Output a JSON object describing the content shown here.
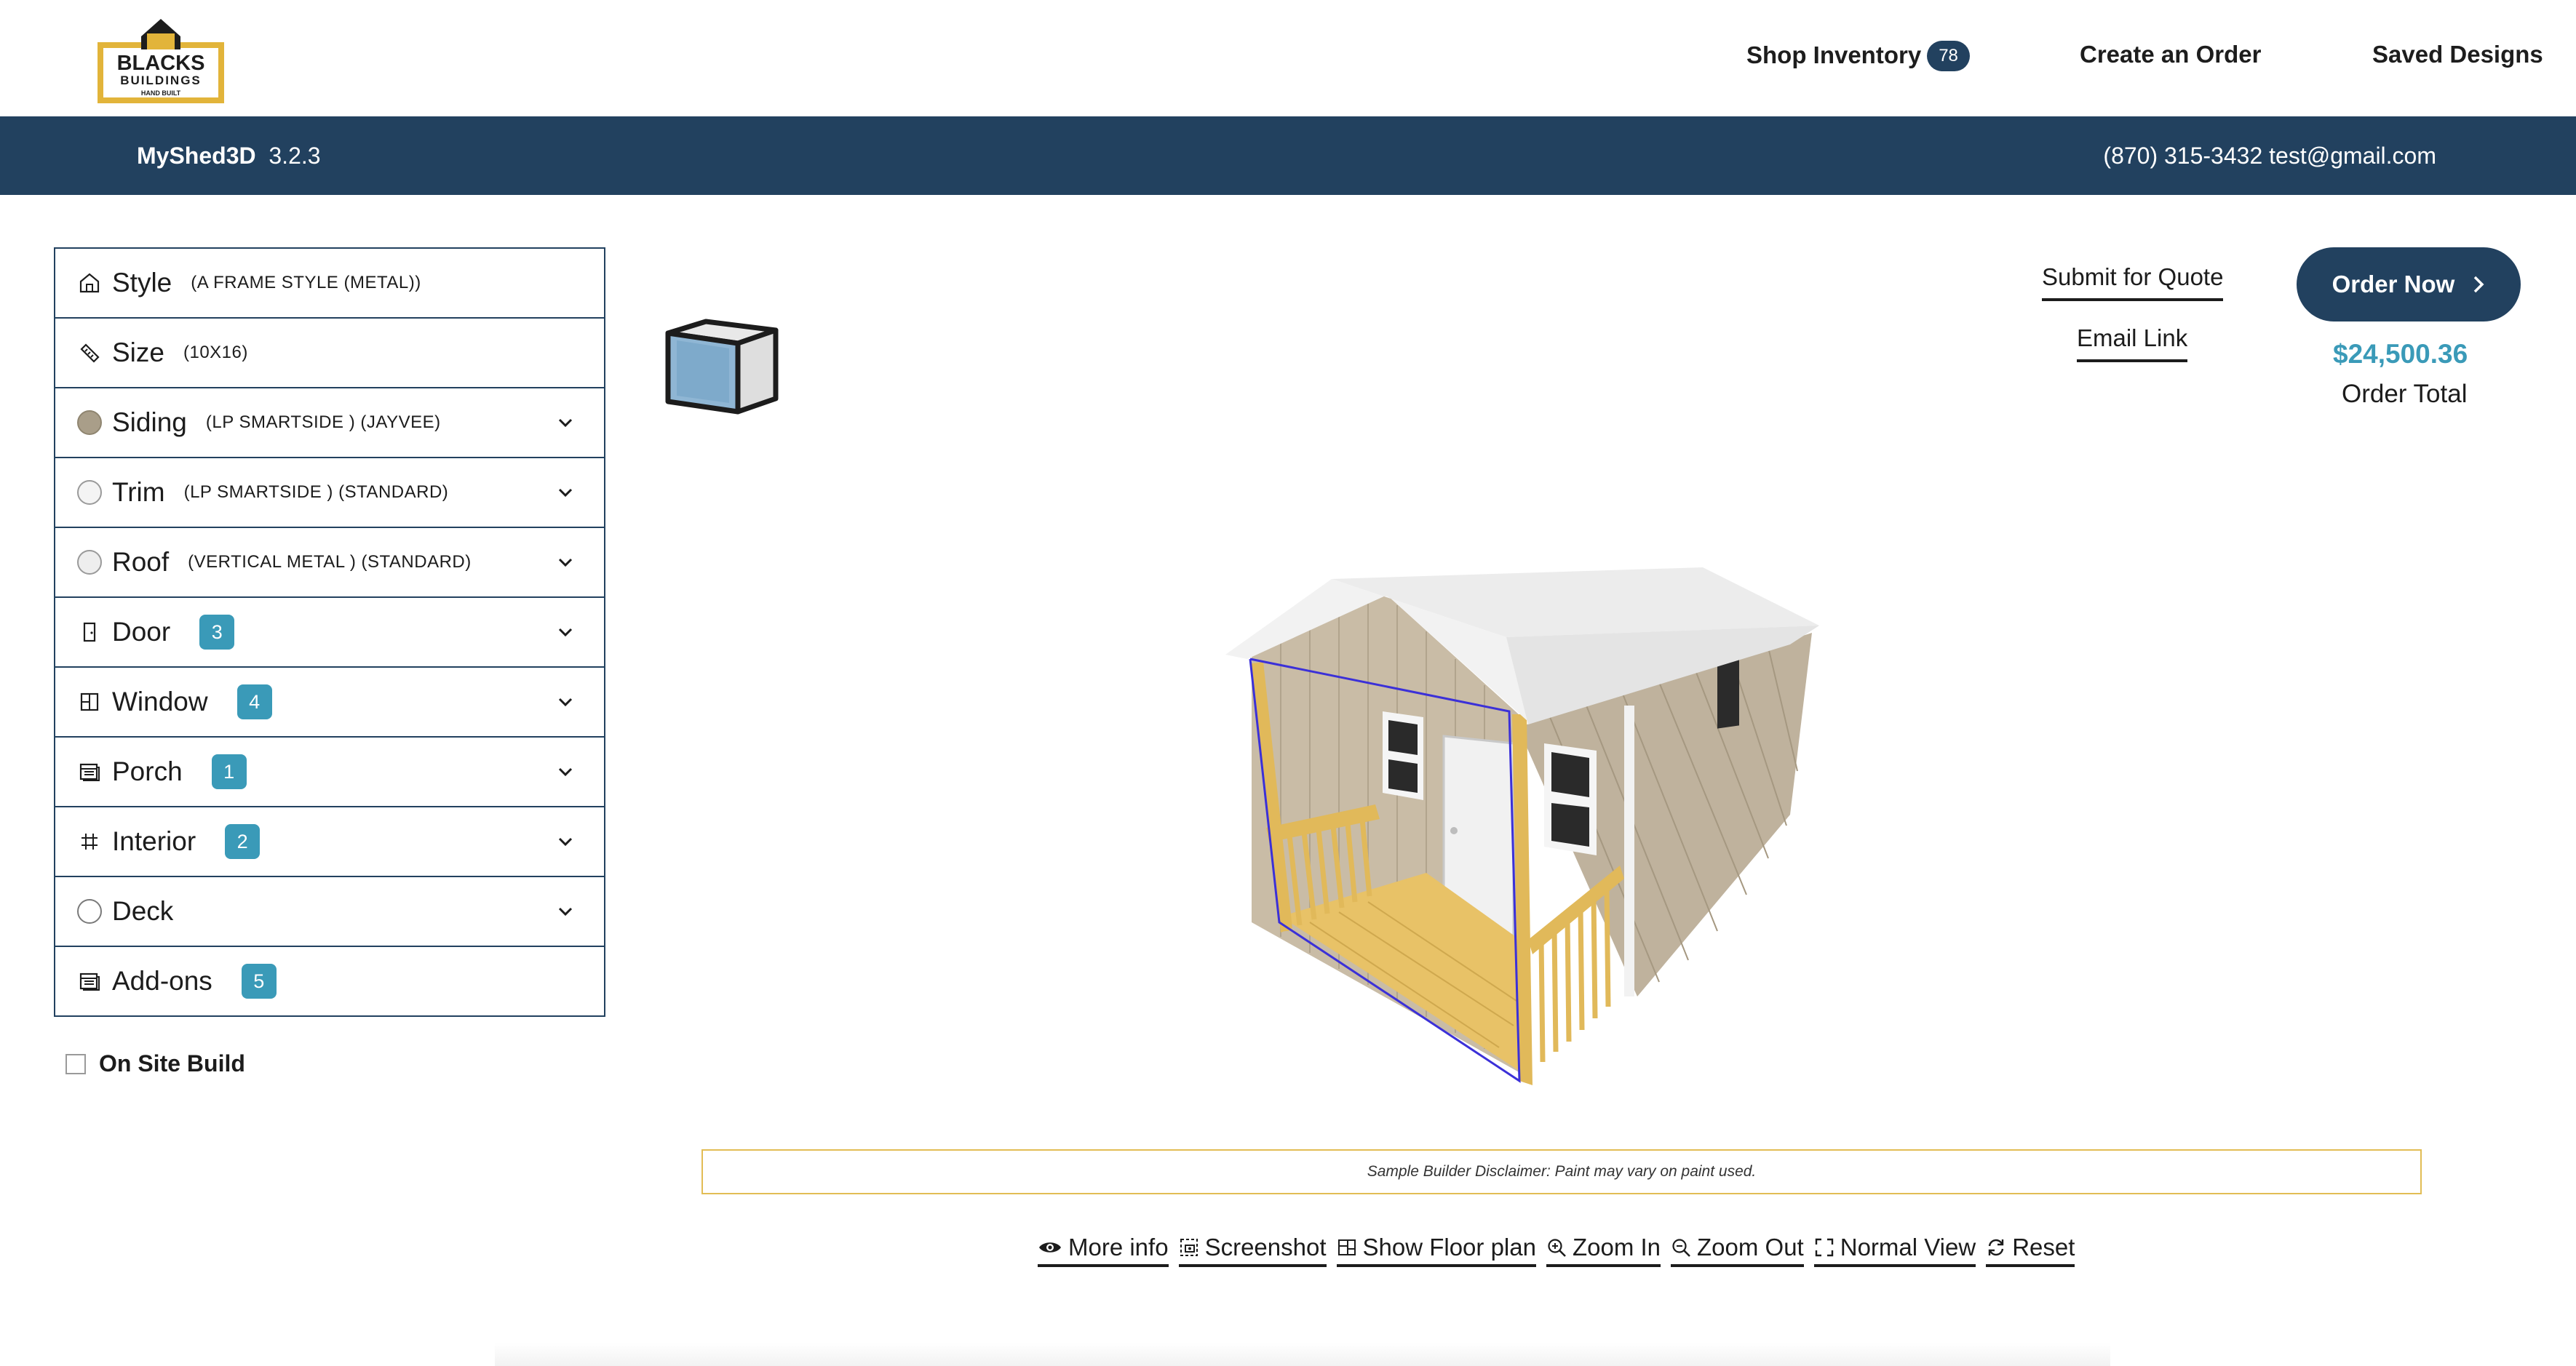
{
  "header": {
    "logo": {
      "line1": "BLACKS",
      "line2": "BUILDINGS",
      "line3": "HAND BUILT"
    },
    "nav": {
      "shop_inventory": "Shop Inventory",
      "shop_inventory_count": "78",
      "create_order": "Create an Order",
      "saved_designs": "Saved Designs"
    }
  },
  "subheader": {
    "app_name": "MyShed3D",
    "version": "3.2.3",
    "phone": "(870) 315-3432",
    "email": "test@gmail.com"
  },
  "options": [
    {
      "label": "Style",
      "value": "(A FRAME STYLE (METAL))",
      "icon": "house-icon"
    },
    {
      "label": "Size",
      "value": "(10X16)",
      "icon": "ruler-icon"
    },
    {
      "label": "Siding",
      "value": "(LP SMARTSIDE ) (JAYVEE)",
      "icon": "color-swatch",
      "swatch": "#a99e89",
      "expandable": true
    },
    {
      "label": "Trim",
      "value": "(LP SMARTSIDE ) (STANDARD)",
      "icon": "color-swatch",
      "swatch": "#f4f4f4",
      "expandable": true
    },
    {
      "label": "Roof",
      "value": "(VERTICAL METAL ) (STANDARD)",
      "icon": "color-swatch",
      "swatch": "#eeeeee",
      "expandable": true
    },
    {
      "label": "Door",
      "count": "3",
      "icon": "door-icon",
      "expandable": true
    },
    {
      "label": "Window",
      "count": "4",
      "icon": "window-icon",
      "expandable": true
    },
    {
      "label": "Porch",
      "count": "1",
      "icon": "porch-icon",
      "expandable": true
    },
    {
      "label": "Interior",
      "count": "2",
      "icon": "grid-icon",
      "expandable": true
    },
    {
      "label": "Deck",
      "icon": "empty-circle",
      "expandable": true
    },
    {
      "label": "Add-ons",
      "count": "5",
      "icon": "addons-icon"
    }
  ],
  "on_site_build": {
    "label": "On Site Build",
    "checked": false
  },
  "actions": {
    "submit_quote": "Submit for Quote",
    "email_link": "Email Link",
    "order_now": "Order Now",
    "price": "$24,500.36",
    "order_total_label": "Order Total"
  },
  "disclaimer": "Sample Builder Disclaimer: Paint may vary on paint used.",
  "toolbar": {
    "more_info": "More info",
    "screenshot": "Screenshot",
    "floor_plan": "Show Floor plan",
    "zoom_in": "Zoom In",
    "zoom_out": "Zoom Out",
    "normal_view": "Normal View",
    "reset": "Reset"
  },
  "colors": {
    "navy": "#22415f",
    "accent": "#3a9ab8",
    "logo_gold": "#e2b43a",
    "disclaimer_border": "#e2bd55",
    "siding": "#a99e89",
    "porch_wood": "#e8c267"
  }
}
